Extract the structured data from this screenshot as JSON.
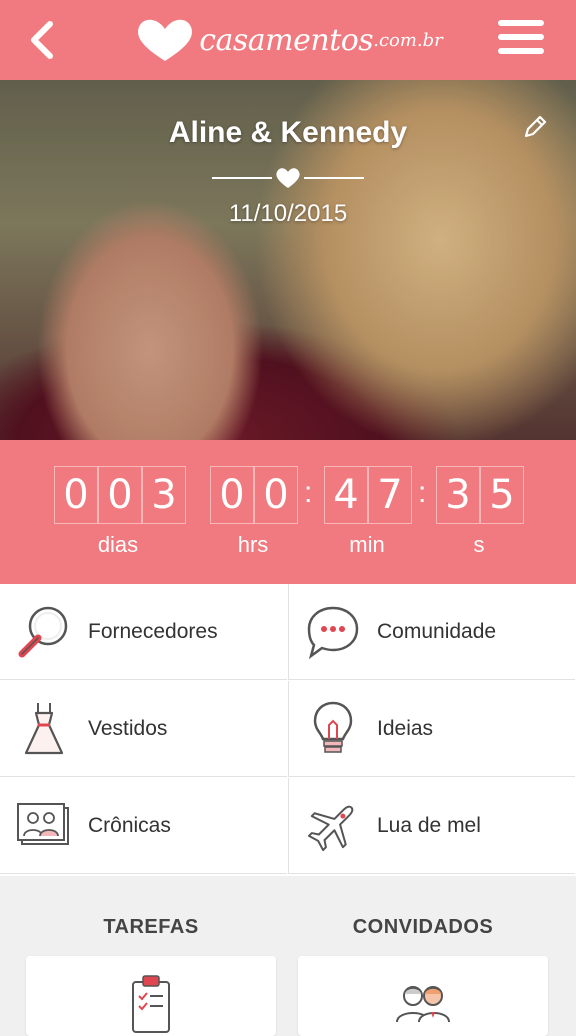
{
  "header": {
    "logo_text": "casamentos",
    "logo_tld": ".com.br",
    "brand_color": "#f07a7f"
  },
  "hero": {
    "couple_names": "Aline & Kennedy",
    "wedding_date": "11/10/2015"
  },
  "countdown": {
    "days": [
      "0",
      "0",
      "3"
    ],
    "hours": [
      "0",
      "0"
    ],
    "minutes": [
      "4",
      "7"
    ],
    "seconds": [
      "3",
      "5"
    ],
    "labels": {
      "days": "dias",
      "hours": "hrs",
      "minutes": "min",
      "seconds": "s"
    }
  },
  "menu": {
    "items": [
      {
        "label": "Fornecedores",
        "icon": "magnifier-icon"
      },
      {
        "label": "Comunidade",
        "icon": "chat-bubble-icon"
      },
      {
        "label": "Vestidos",
        "icon": "dress-icon"
      },
      {
        "label": "Ideias",
        "icon": "lightbulb-icon"
      },
      {
        "label": "Crônicas",
        "icon": "photo-album-icon"
      },
      {
        "label": "Lua de mel",
        "icon": "airplane-icon"
      }
    ]
  },
  "sections": {
    "tasks_title": "TAREFAS",
    "guests_title": "CONVIDADOS"
  }
}
